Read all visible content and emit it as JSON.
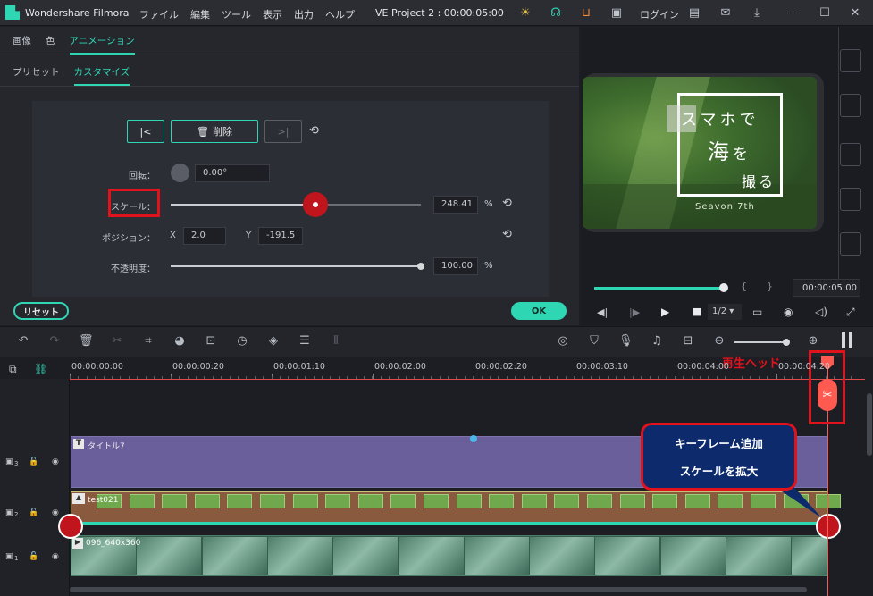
{
  "app": {
    "title": "Wondershare Filmora",
    "project": "VE Project 2 : 00:00:05:00",
    "login": "ログイン"
  },
  "menu": [
    "ファイル",
    "編集",
    "ツール",
    "表示",
    "出力",
    "ヘルプ"
  ],
  "panel": {
    "tabs": [
      "画像",
      "色",
      "アニメーション"
    ],
    "subtabs": [
      "プリセット",
      "カスタマイズ"
    ],
    "delete_label": "削除",
    "rotation_label": "回転：",
    "rotation_value": "0.00°",
    "scale_label": "スケール：",
    "scale_value": "248.41",
    "scale_unit": "%",
    "scale_fraction": 0.58,
    "position_label": "ポジション：",
    "pos_x_label": "X",
    "pos_x": "2.0",
    "pos_y_label": "Y",
    "pos_y": "-191.5",
    "opacity_label": "不透明度：",
    "opacity_value": "100.00",
    "opacity_unit": "%",
    "opacity_fraction": 1.0,
    "reset_label": "リセット",
    "ok_label": "OK"
  },
  "preview": {
    "line1": "スマホで",
    "line2a": "海",
    "line2b": "を",
    "line3": "撮る",
    "caption": "Seavon 7th",
    "time": "00:00:05:00",
    "bracket_open": "{",
    "bracket_close": "}",
    "ratio": "1/2",
    "progress": 1.0
  },
  "timeline": {
    "ticks": [
      "00:00:00:00",
      "00:00:00:20",
      "00:00:01:10",
      "00:00:02:00",
      "00:00:02:20",
      "00:00:03:10",
      "00:00:04:00",
      "00:00:04:20"
    ],
    "tracks": [
      {
        "num": "3",
        "clip": "タイトル7"
      },
      {
        "num": "2",
        "clip": "test021"
      },
      {
        "num": "1",
        "clip": "096_640x360"
      }
    ]
  },
  "annotations": {
    "playhead_label": "再生ヘッド",
    "callout_line1": "キーフレーム追加",
    "callout_line2": "スケールを拡大",
    "accent_red": "#e0131c",
    "accent_teal": "#2fd6b4"
  }
}
